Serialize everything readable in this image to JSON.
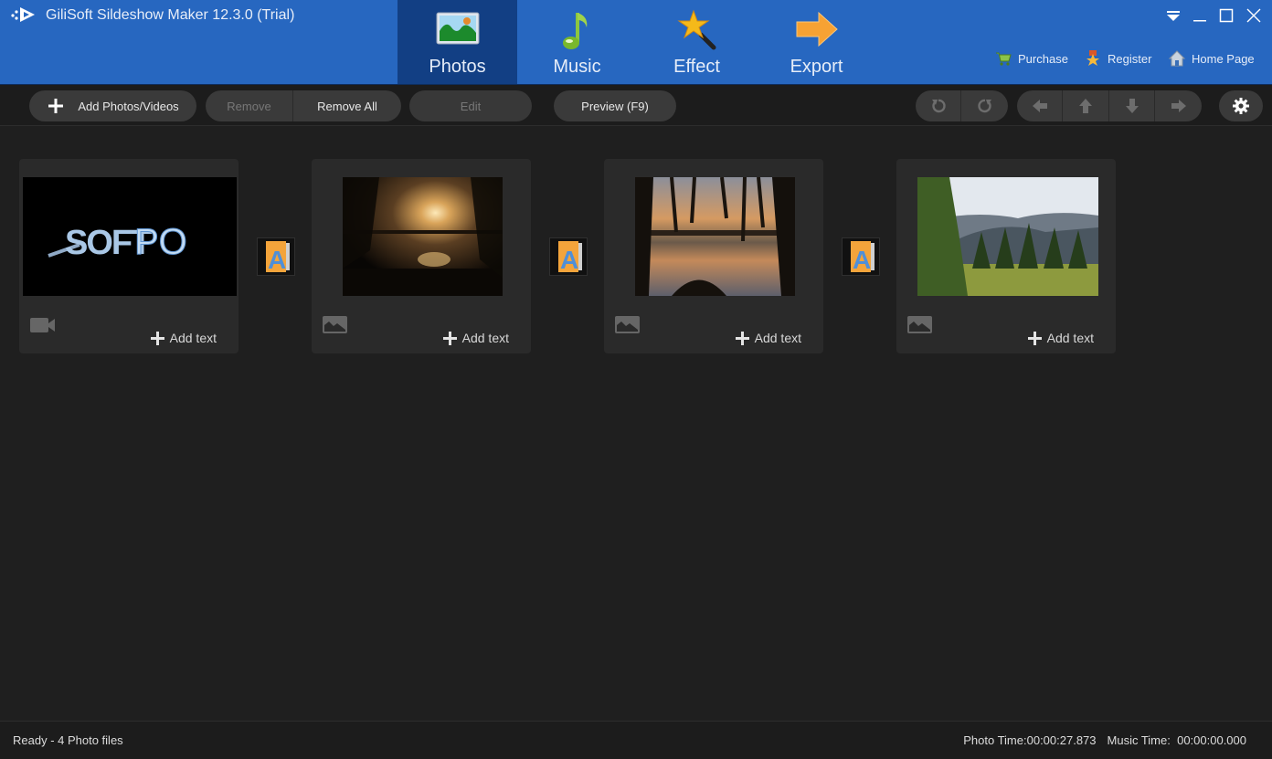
{
  "app": {
    "title": "GiliSoft Sildeshow Maker 12.3.0 (Trial)",
    "accent_color": "#2767c0",
    "active_tab_color": "#123f84"
  },
  "nav_tabs": [
    {
      "label": "Photos",
      "icon": "photo-landscape-icon",
      "active": true
    },
    {
      "label": "Music",
      "icon": "music-note-icon",
      "active": false
    },
    {
      "label": "Effect",
      "icon": "magic-wand-star-icon",
      "active": false
    },
    {
      "label": "Export",
      "icon": "arrow-right-icon",
      "active": false
    }
  ],
  "window_controls": [
    "dropdown-menu-icon",
    "minimize-icon",
    "maximize-icon",
    "close-icon"
  ],
  "top_links": [
    {
      "label": "Purchase",
      "icon": "shopping-cart-icon"
    },
    {
      "label": "Register",
      "icon": "medal-star-icon"
    },
    {
      "label": "Home Page",
      "icon": "home-icon"
    }
  ],
  "toolbar": {
    "add": "Add Photos/Videos",
    "remove": "Remove",
    "remove_all": "Remove All",
    "edit": "Edit",
    "preview": "Preview (F9)",
    "rotate_left_icon": "rotate-left-icon",
    "rotate_right_icon": "rotate-right-icon",
    "move_icons": [
      "arrow-left-icon",
      "arrow-up-icon",
      "arrow-down-icon",
      "arrow-right-icon"
    ],
    "settings_icon": "gear-icon"
  },
  "items": [
    {
      "type": "video",
      "thumbnail": "SOFTPO logo on black",
      "add_text": "Add text"
    },
    {
      "type": "photo",
      "thumbnail": "Sunset through willow trees over lake",
      "add_text": "Add text"
    },
    {
      "type": "photo",
      "thumbnail": "Sunset lake with hanging willow branches",
      "add_text": "Add text"
    },
    {
      "type": "photo",
      "thumbnail": "Forest and mountain landscape",
      "add_text": "Add text"
    }
  ],
  "transitions": [
    {
      "icon": "transition-letter-a-icon"
    },
    {
      "icon": "transition-letter-a-icon"
    },
    {
      "icon": "transition-letter-a-icon"
    }
  ],
  "status": {
    "left": "Ready - 4 Photo files",
    "photo_time_label": "Photo Time:",
    "photo_time": "00:00:27.873",
    "music_time_label": "Music Time:",
    "music_time": "00:00:00.000"
  }
}
